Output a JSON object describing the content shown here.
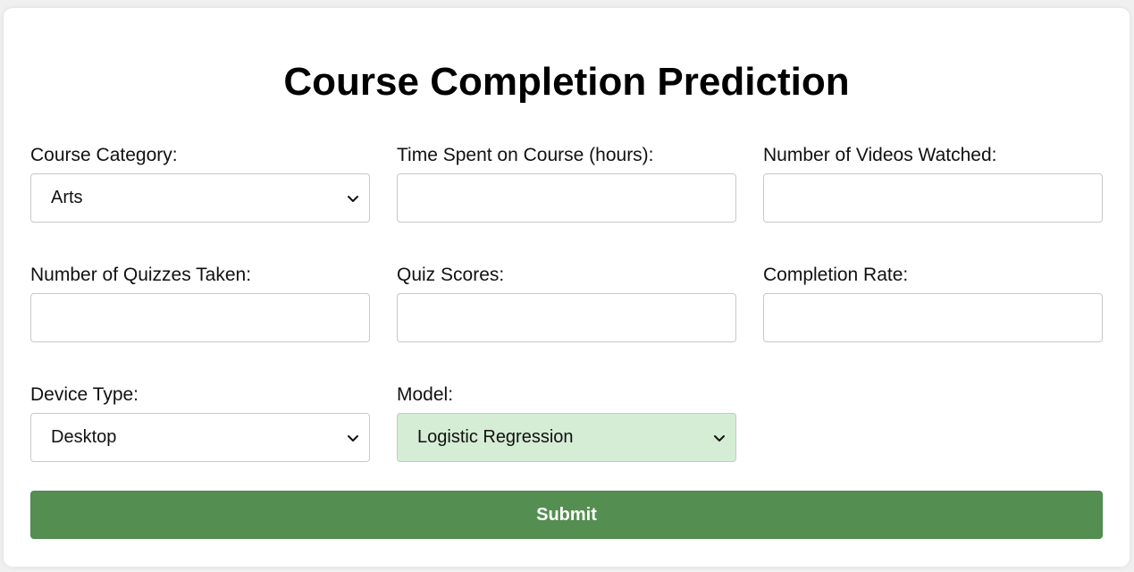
{
  "page": {
    "title": "Course Completion Prediction"
  },
  "form": {
    "course_category": {
      "label": "Course Category:",
      "value": "Arts"
    },
    "time_spent": {
      "label": "Time Spent on Course (hours):",
      "value": "",
      "placeholder": ""
    },
    "videos_watched": {
      "label": "Number of Videos Watched:",
      "value": "",
      "placeholder": ""
    },
    "quizzes_taken": {
      "label": "Number of Quizzes Taken:",
      "value": "",
      "placeholder": ""
    },
    "quiz_scores": {
      "label": "Quiz Scores:",
      "value": "",
      "placeholder": ""
    },
    "completion_rate": {
      "label": "Completion Rate:",
      "value": "",
      "placeholder": ""
    },
    "device_type": {
      "label": "Device Type:",
      "value": "Desktop"
    },
    "model": {
      "label": "Model:",
      "value": "Logistic Regression"
    },
    "submit_label": "Submit"
  },
  "icons": {
    "select_chevron": "chevron-down-icon"
  },
  "colors": {
    "submit_bg": "#548e50",
    "model_select_bg": "#d5ecd5",
    "card_bg": "#ffffff",
    "page_bg": "#f0f0f0"
  }
}
